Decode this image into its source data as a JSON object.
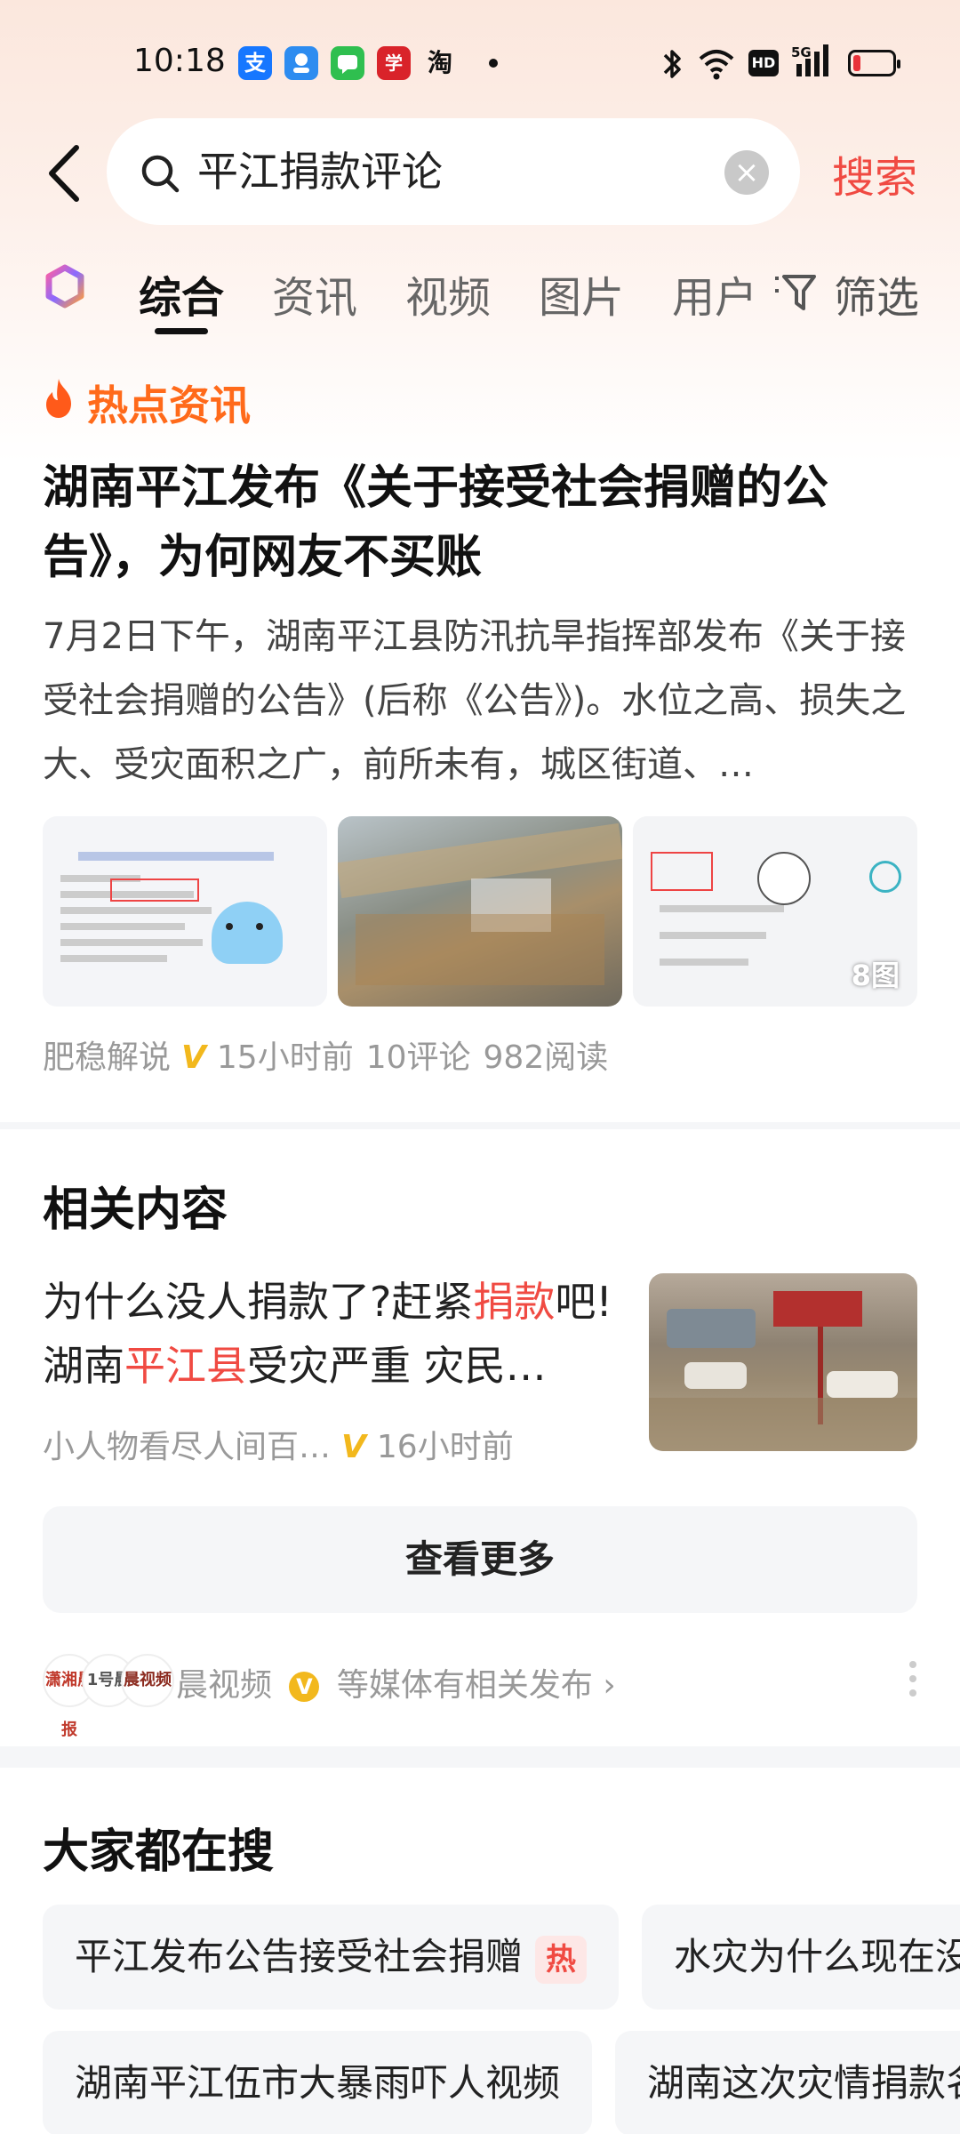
{
  "status_bar": {
    "time": "10:18",
    "apps": [
      "支",
      "",
      "",
      "学",
      "淘"
    ],
    "network": "5G",
    "hd": "HD"
  },
  "search": {
    "query": "平江捐款评论",
    "submit_label": "搜索"
  },
  "tabs": [
    {
      "label": "综合",
      "active": true
    },
    {
      "label": "资讯",
      "active": false
    },
    {
      "label": "视频",
      "active": false
    },
    {
      "label": "图片",
      "active": false
    },
    {
      "label": "用户",
      "active": false
    }
  ],
  "filter_label": "筛选",
  "hot_news": {
    "badge": "热点资讯",
    "title": "湖南平江发布《关于接受社会捐赠的公告》，为何网友不买账",
    "summary": "7月2日下午，湖南平江县防汛抗旱指挥部发布《关于接受社会捐赠的公告》(后称《公告》)。水位之高、损失之大、受灾面积之广，前所未有，城区街道、…",
    "image_count": "8图",
    "author": "肥稳解说",
    "time_ago": "15小时前",
    "comments": "10评论",
    "reads": "982阅读"
  },
  "related": {
    "section_title": "相关内容",
    "item": {
      "title_parts": [
        "为什么没人捐款了?赶紧",
        "捐款",
        "吧! 湖南",
        "平江县",
        "受灾严重 灾民…"
      ],
      "author": "小人物看尽人间百…",
      "time_ago": "16小时前"
    },
    "more_label": "查看更多",
    "media_text": "晨视频",
    "media_suffix": "等媒体有相关发布 ›",
    "media_logos": [
      "潇湘晨报",
      "1号晨",
      "晨视频"
    ]
  },
  "trending": {
    "section_title": "大家都在搜",
    "chips": [
      {
        "label": "平江发布公告接受社会捐赠",
        "hot": "热"
      },
      {
        "label": "水灾为什么现在没",
        "hot": ""
      },
      {
        "label": "湖南平江伍市大暴雨吓人视频",
        "hot": ""
      },
      {
        "label": "湖南这次灾情捐款名",
        "hot": ""
      }
    ]
  },
  "colors": {
    "accent_red": "#f04a42",
    "hot_orange": "#ff6a1a",
    "verified_gold": "#f2b81d"
  }
}
